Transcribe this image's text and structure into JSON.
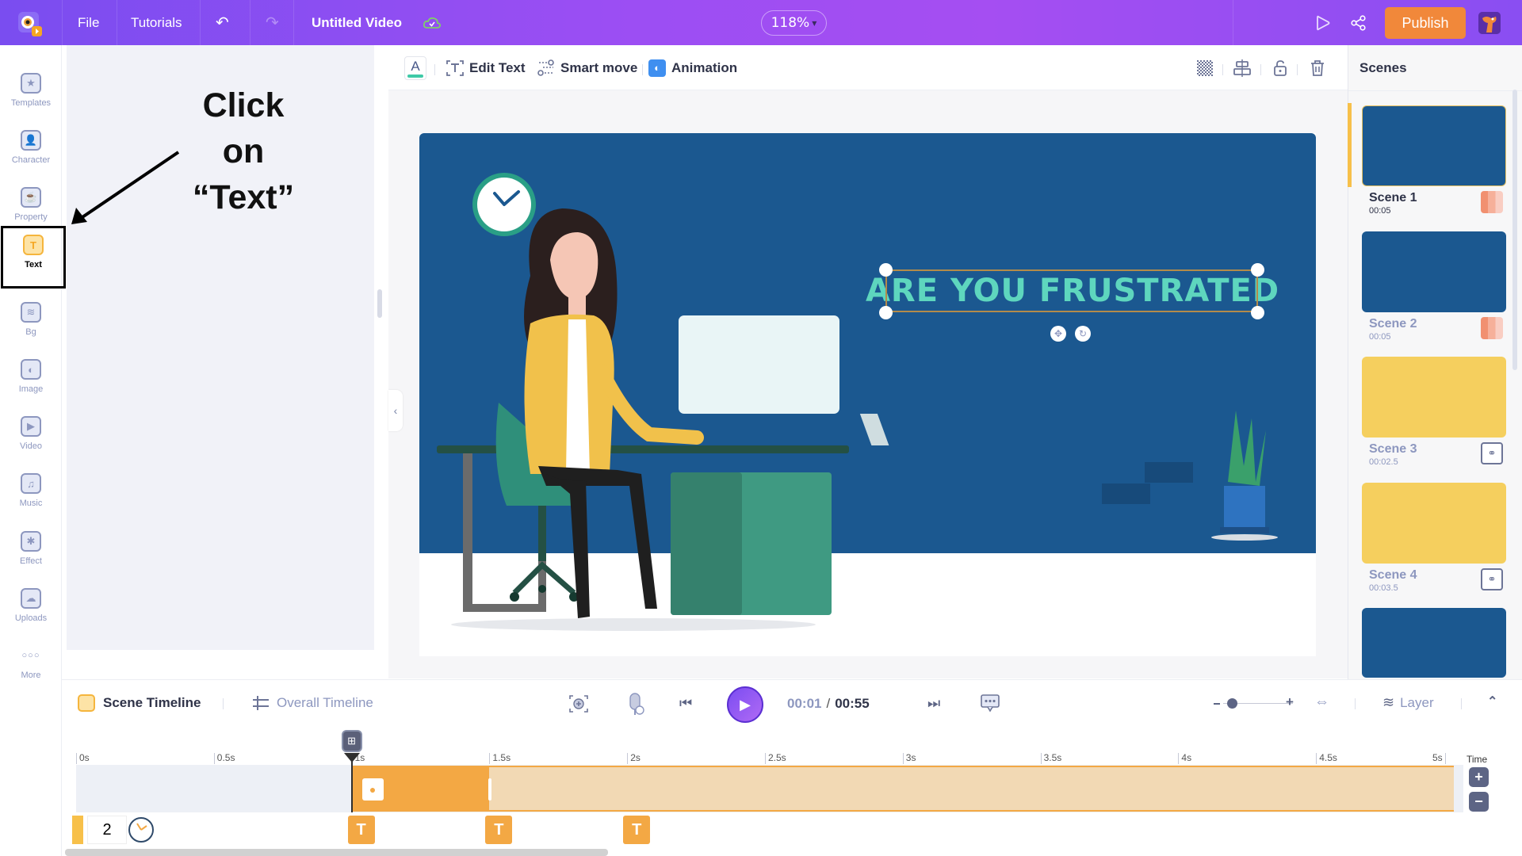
{
  "topbar": {
    "file_label": "File",
    "tutorials_label": "Tutorials",
    "undo_icon": "undo-icon",
    "redo_icon": "redo-icon",
    "project_title": "Untitled Video",
    "cloud_status_icon": "cloud-check-icon",
    "zoom_level": "118%",
    "preview_icon": "play-outline-icon",
    "share_icon": "share-icon",
    "publish_label": "Publish"
  },
  "rail": {
    "items": [
      {
        "label": "Templates",
        "icon": "clapperboard-icon",
        "glyph": "★"
      },
      {
        "label": "Character",
        "icon": "person-icon",
        "glyph": "👤"
      },
      {
        "label": "Property",
        "icon": "cup-icon",
        "glyph": "☕"
      },
      {
        "label": "Text",
        "icon": "text-icon",
        "glyph": "T",
        "active": true
      },
      {
        "label": "Bg",
        "icon": "layers-icon",
        "glyph": "≋"
      },
      {
        "label": "Image",
        "icon": "image-icon",
        "glyph": "◐"
      },
      {
        "label": "Video",
        "icon": "video-icon",
        "glyph": "▶"
      },
      {
        "label": "Music",
        "icon": "music-icon",
        "glyph": "♫"
      },
      {
        "label": "Effect",
        "icon": "sparkle-icon",
        "glyph": "✱"
      },
      {
        "label": "Uploads",
        "icon": "cloud-upload-icon",
        "glyph": "☁"
      },
      {
        "label": "More",
        "icon": "more-dots-icon",
        "glyph": "○○○"
      }
    ]
  },
  "annotation": {
    "line1": "Click on",
    "line2": "“Text”"
  },
  "toolbar": {
    "font_color_label": "A",
    "font_color_accent": "#3ec9a7",
    "edit_text_label": "Edit Text",
    "smart_move_label": "Smart move",
    "animation_label": "Animation"
  },
  "canvas": {
    "headline": "ARE YOU FRUSTRATED",
    "headline_color": "#5ed6be",
    "background_color": "#1b5890"
  },
  "scenes": {
    "title": "Scenes",
    "items": [
      {
        "name": "Scene 1",
        "duration": "00:05",
        "color": "#1b5890",
        "badge": "trans",
        "active": true
      },
      {
        "name": "Scene 2",
        "duration": "00:05",
        "color": "#1b5890",
        "badge": "trans"
      },
      {
        "name": "Scene 3",
        "duration": "00:02.5",
        "color": "#f5cf5e",
        "badge": "link"
      },
      {
        "name": "Scene 4",
        "duration": "00:03.5",
        "color": "#f5cf5e",
        "badge": "link"
      },
      {
        "name": "",
        "duration": "",
        "color": "#1b5890"
      }
    ]
  },
  "bottom": {
    "scene_timeline_label": "Scene Timeline",
    "overall_timeline_label": "Overall Timeline",
    "current_time": "00:01",
    "separator": "/",
    "total_time": "00:55",
    "layer_label": "Layer",
    "zoom_slider_value": 0.12
  },
  "timeline": {
    "ticks": [
      "0s",
      "0.5s",
      "1s",
      "1.5s",
      "2s",
      "2.5s",
      "3s",
      "3.5s",
      "4s",
      "4.5s",
      "5s"
    ],
    "time_label": "Time",
    "playhead_time_s": 1.0,
    "element_start_s": 1.0,
    "element_animation_end_s": 1.5,
    "element_end_s": 5.0,
    "text_markers_s": [
      1.0,
      1.5,
      2.0
    ],
    "marker_glyph": "T",
    "scene_number": "2"
  }
}
